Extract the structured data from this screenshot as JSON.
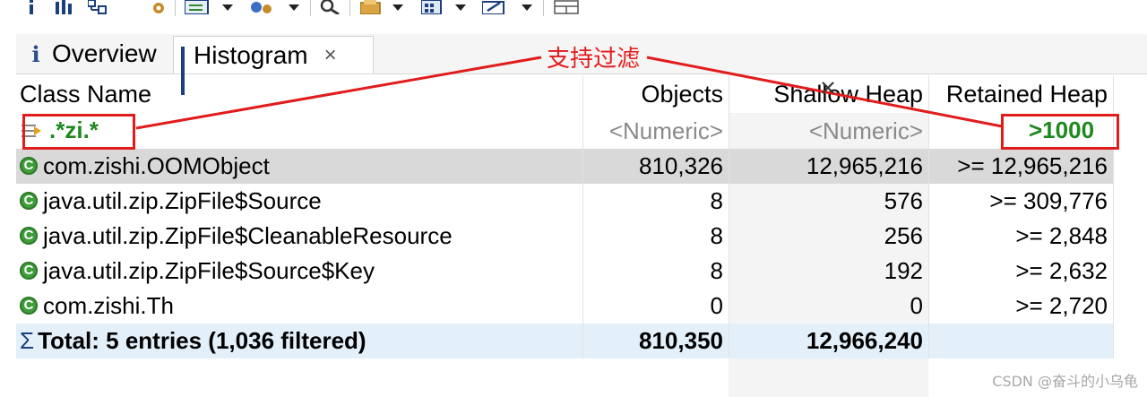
{
  "tabs": [
    {
      "label": "Overview",
      "icon": "info-icon"
    },
    {
      "label": "Histogram",
      "icon": "histogram-icon",
      "close": "×"
    }
  ],
  "columns": [
    "Class Name",
    "Objects",
    "Shallow Heap",
    "Retained Heap"
  ],
  "filter_row": {
    "class_filter": ".*zi.*",
    "objects_placeholder": "<Numeric>",
    "shallow_placeholder": "<Numeric>",
    "retained_filter": ">1000"
  },
  "rows": [
    {
      "name": "com.zishi.OOMObject",
      "objects": "810,326",
      "shallow": "12,965,216",
      "retained": ">= 12,965,216",
      "selected": true
    },
    {
      "name": "java.util.zip.ZipFile$Source",
      "objects": "8",
      "shallow": "576",
      "retained": ">= 309,776"
    },
    {
      "name": "java.util.zip.ZipFile$CleanableResource",
      "objects": "8",
      "shallow": "256",
      "retained": ">= 2,848"
    },
    {
      "name": "java.util.zip.ZipFile$Source$Key",
      "objects": "8",
      "shallow": "192",
      "retained": ">= 2,632"
    },
    {
      "name": "com.zishi.Th",
      "objects": "0",
      "shallow": "0",
      "retained": ">= 2,720"
    }
  ],
  "total": {
    "label": "Total: 5 entries (1,036 filtered)",
    "objects": "810,350",
    "shallow": "12,966,240"
  },
  "annotation": {
    "callout": "支持过滤",
    "color": "#e21b1b"
  },
  "watermark": "CSDN @奋斗的小乌龟",
  "colors": {
    "accent_green": "#1e8a1e",
    "selected_row": "#d9d9d9",
    "total_row": "#e3f0fa"
  }
}
